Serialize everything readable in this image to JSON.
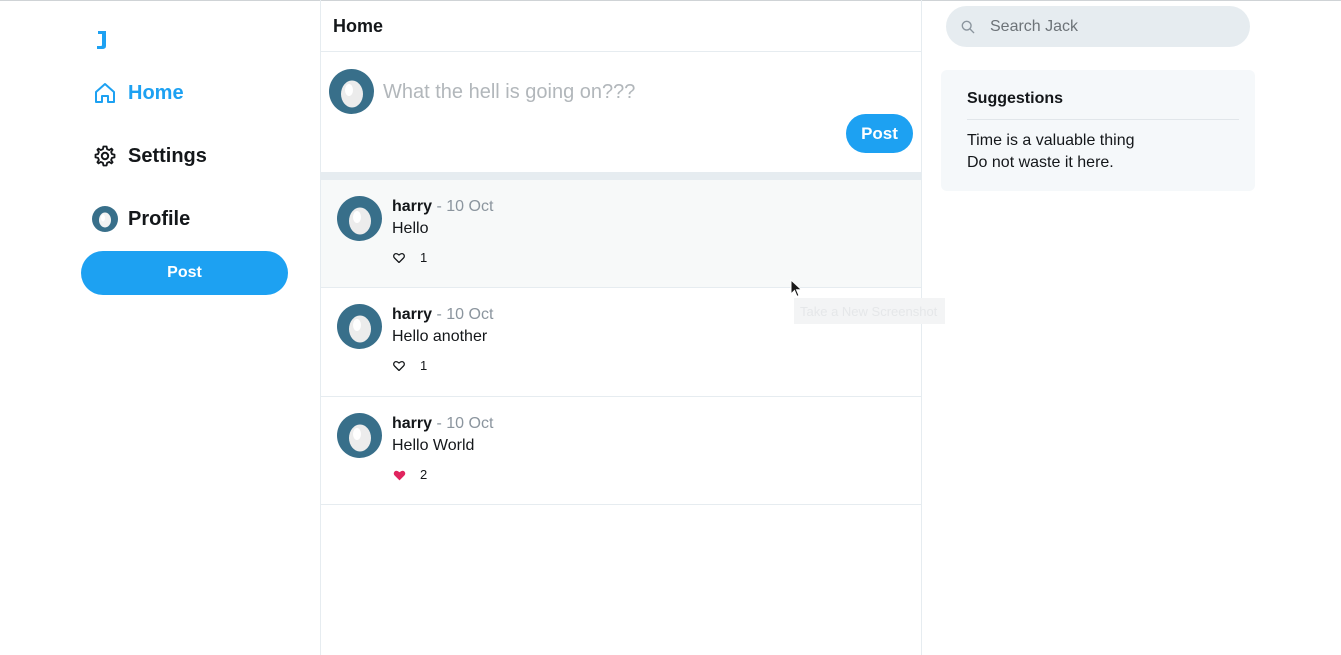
{
  "nav": {
    "logo_icon": "bird-logo-icon",
    "items": [
      {
        "label": "Home",
        "icon": "home-icon",
        "active": true
      },
      {
        "label": "Settings",
        "icon": "gear-icon",
        "active": false
      },
      {
        "label": "Profile",
        "icon": "avatar-icon",
        "active": false
      }
    ],
    "post_label": "Post"
  },
  "main": {
    "title": "Home",
    "composer": {
      "placeholder": "What the hell is going on???",
      "post_label": "Post"
    },
    "posts": [
      {
        "user": "harry",
        "meta": " - 10 Oct",
        "text": "Hello",
        "likes": "1",
        "liked": false
      },
      {
        "user": "harry",
        "meta": " - 10 Oct",
        "text": "Hello another",
        "likes": "1",
        "liked": false
      },
      {
        "user": "harry",
        "meta": " - 10 Oct",
        "text": "Hello World",
        "likes": "2",
        "liked": true
      }
    ]
  },
  "sidebar": {
    "search_placeholder": "Search Jack",
    "suggestions_title": "Suggestions",
    "suggestion_lines": [
      "Time is a valuable thing",
      "Do not waste it here."
    ]
  },
  "tooltip": {
    "text": "Take a New Screenshot"
  },
  "colors": {
    "accent": "#1da1f2",
    "like": "#e0245e",
    "avatar_bg": "#386f8a"
  }
}
